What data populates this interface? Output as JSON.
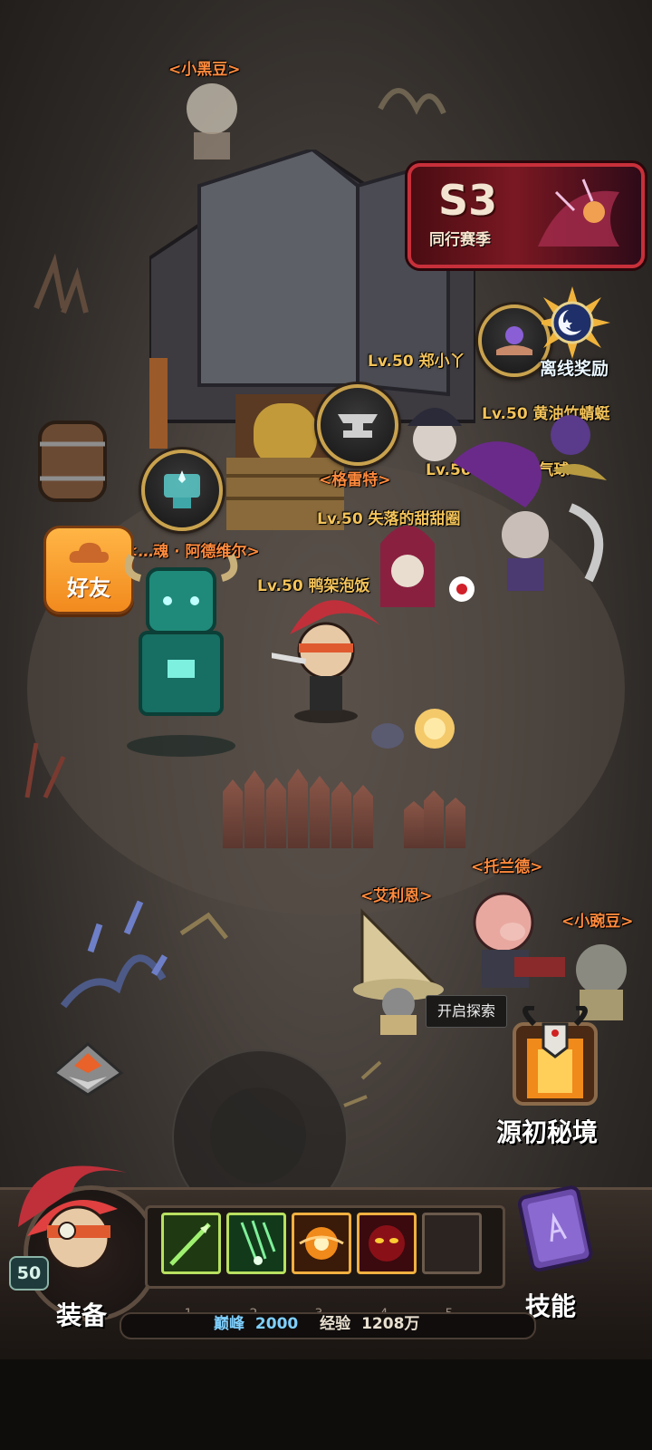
{
  "npc_names": {
    "xiaoheidou": "<小黑豆>",
    "geleite": "<格雷特>",
    "adeweier": "<…魂 · 阿德维尔>",
    "ailien": "<艾利恩>",
    "tuolande": "<托兰德>",
    "xiaowandou": "<小豌豆>"
  },
  "players": [
    {
      "label": "Lv.50 郑小丫"
    },
    {
      "label": "Lv.50 黄油竹蜻蜓"
    },
    {
      "label": "Lv.50 咆哮的热气球"
    },
    {
      "label": "Lv.50 失落的甜甜圈"
    },
    {
      "label": "Lv.50 鸭架泡饭"
    }
  ],
  "season": {
    "tag": "S3",
    "subtitle": "同行赛季"
  },
  "offline_reward": {
    "label": "离线奖励"
  },
  "friend_button": {
    "label": "好友"
  },
  "explore": {
    "tooltip": "开启探索",
    "realm_label": "源初秘境"
  },
  "hud": {
    "hero_level": "50",
    "equip_label": "装备",
    "skill_label": "技能",
    "slot_numbers": [
      "1",
      "2",
      "3",
      "4",
      "5"
    ],
    "peak_label": "巅峰",
    "peak_value": "2000",
    "exp_label": "经验",
    "exp_value": "1208万"
  },
  "colors": {
    "npc_name": "#ff8a3d",
    "player_level": "#f3c35a",
    "peak_value": "#7fd0ff"
  },
  "icons": [
    "anvil-icon",
    "crystal-anvil-icon",
    "moon-sun-icon",
    "cloud-icon",
    "skull-portal-icon",
    "skill-book-icon",
    "diamond-nav-icon"
  ]
}
